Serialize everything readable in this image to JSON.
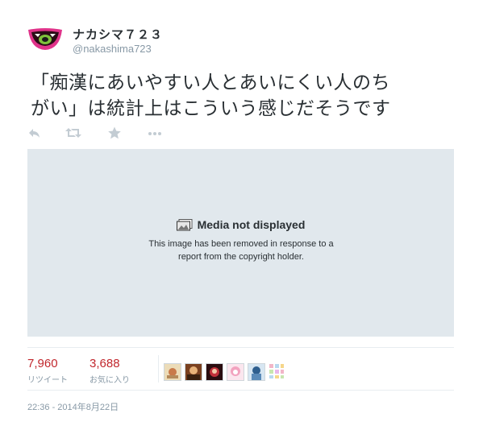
{
  "user": {
    "display_name": "ナカシマ７２３",
    "handle": "@nakashima723"
  },
  "tweet": {
    "text_line1": "「痴漢にあいやすい人とあいにくい人のち",
    "text_line2": "がい」は統計上はこういう感じだそうです"
  },
  "actions": {
    "icons": [
      "reply-icon",
      "retweet-icon",
      "favorite-star-icon",
      "more-icon"
    ]
  },
  "media": {
    "title": "Media not displayed",
    "message_line1": "This image has been removed in response to a",
    "message_line2": "report from the copyright holder."
  },
  "stats": {
    "retweets": {
      "count": "7,960",
      "label": "リツイート"
    },
    "favorites": {
      "count": "3,688",
      "label": "お気に入り"
    }
  },
  "favoriters": {
    "avatar_colors": [
      "#e9d9b6",
      "#8a4a25",
      "#7a1e24",
      "#f0b4c6",
      "#3f6f9e",
      "#f5f5f5"
    ]
  },
  "timestamp": "22:36 - 2014年8月22日",
  "colors": {
    "stat_number": "#c1272d",
    "muted": "#8899a6",
    "media_bg": "#e1e8ed"
  }
}
